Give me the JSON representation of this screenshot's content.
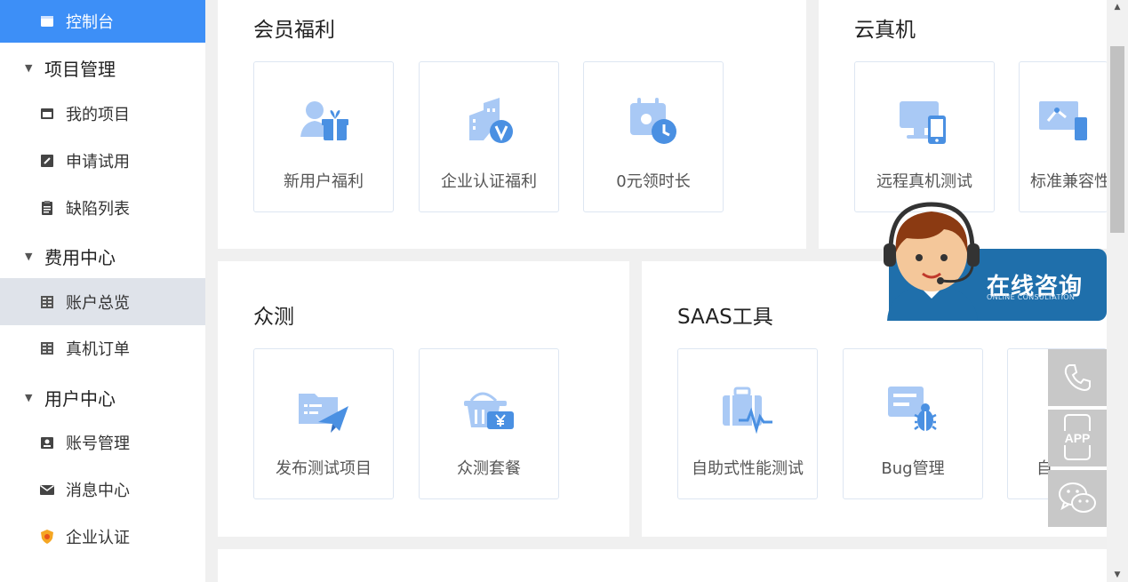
{
  "sidebar": {
    "items": [
      {
        "label": "控制台",
        "kind": "sub",
        "state": "active",
        "icon": "console-icon"
      },
      {
        "label": "项目管理",
        "kind": "group"
      },
      {
        "label": "我的项目",
        "kind": "sub",
        "icon": "project-icon"
      },
      {
        "label": "申请试用",
        "kind": "sub",
        "icon": "edit-icon"
      },
      {
        "label": "缺陷列表",
        "kind": "sub",
        "icon": "clipboard-icon"
      },
      {
        "label": "费用中心",
        "kind": "group"
      },
      {
        "label": "账户总览",
        "kind": "sub",
        "state": "hover",
        "icon": "ledger-icon"
      },
      {
        "label": "真机订单",
        "kind": "sub",
        "icon": "ledger-icon"
      },
      {
        "label": "用户中心",
        "kind": "group"
      },
      {
        "label": "账号管理",
        "kind": "sub",
        "icon": "id-card-icon"
      },
      {
        "label": "消息中心",
        "kind": "sub",
        "icon": "mail-icon"
      },
      {
        "label": "企业认证",
        "kind": "sub",
        "icon": "shield-badge-icon"
      }
    ]
  },
  "panels": {
    "member": {
      "title": "会员福利",
      "tiles": [
        "新用户福利",
        "企业认证福利",
        "0元领时长"
      ]
    },
    "cloud": {
      "title": "云真机",
      "tiles": [
        "远程真机测试",
        "标准兼容性"
      ]
    },
    "crowd": {
      "title": "众测",
      "tiles": [
        "发布测试项目",
        "众测套餐"
      ]
    },
    "saas": {
      "title": "SAAS工具",
      "tiles": [
        "自助式性能测试",
        "Bug管理",
        "自"
      ]
    }
  },
  "consult": {
    "title": "在线咨询",
    "subtitle": "ONLINE CONSULTATION"
  },
  "float_buttons": {
    "app_label": "APP"
  },
  "colors": {
    "accent": "#3d8ff7",
    "icon_blue": "#4a90e2",
    "icon_light": "#a9c9f5"
  }
}
